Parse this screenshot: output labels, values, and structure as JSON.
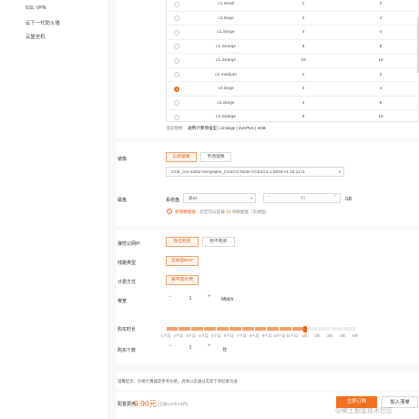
{
  "sidebar": {
    "items": [
      {
        "label": "SSL VPN"
      },
      {
        "label": "云下一代防火墙"
      },
      {
        "label": "云堡垒机"
      }
    ]
  },
  "spec_table": {
    "rows": [
      {
        "name": "c1.small",
        "vcpu": "1",
        "mem": "2",
        "selected": false
      },
      {
        "name": "c1.large",
        "vcpu": "2",
        "mem": "4",
        "selected": false
      },
      {
        "name": "c1.xlarge",
        "vcpu": "4",
        "mem": "4",
        "selected": false
      },
      {
        "name": "c1.2xlarge",
        "vcpu": "8",
        "mem": "8",
        "selected": false
      },
      {
        "name": "c1.4xlarge",
        "vcpu": "16",
        "mem": "16",
        "selected": false
      },
      {
        "name": "c2.medium",
        "vcpu": "1",
        "mem": "2",
        "selected": false
      },
      {
        "name": "c2.large",
        "vcpu": "2",
        "mem": "4",
        "selected": true
      },
      {
        "name": "c2.xlarge",
        "vcpu": "4",
        "mem": "8",
        "selected": false
      },
      {
        "name": "c2.2xlarge",
        "vcpu": "8",
        "mem": "16",
        "selected": false
      }
    ],
    "current_spec_label": "当前规格:",
    "current_spec_value": "通用计算增强型 | c2.large | 2vCPUs | 4GB"
  },
  "image": {
    "label": "镜像",
    "tabs": [
      {
        "label": "公共镜像",
        "active": true
      },
      {
        "label": "市场镜像",
        "active": false
      }
    ],
    "selected": "CCE_cce-addon-templates_CentOS-Node-CCE20.6.1.B003-v1.15.11-r1"
  },
  "disk": {
    "label": "磁盘",
    "system_label": "系统盘",
    "type": "高IO",
    "size": "40",
    "unit": "GB",
    "add_link": "新增数据盘",
    "add_hint_prefix": "您还可以挂载",
    "add_hint_count": "23",
    "add_hint_suffix": "块数据盘（云硬盘）"
  },
  "eip": {
    "label": "弹性公网IP",
    "options": [
      {
        "label": "现在购买",
        "active": true
      },
      {
        "label": "暂不购买",
        "active": false
      }
    ]
  },
  "line": {
    "label": "线路类型",
    "options": [
      {
        "label": "全动态BGP",
        "active": true
      }
    ]
  },
  "billing": {
    "label": "计费方式",
    "options": [
      {
        "label": "按带宽计费",
        "active": true
      }
    ]
  },
  "bandwidth": {
    "label": "带宽",
    "minus": "−",
    "value": "1",
    "plus": "+",
    "unit": "Mbit/s"
  },
  "duration": {
    "label": "购买时长",
    "ticks": [
      "1个月",
      "2个月",
      "3个月",
      "4个月",
      "5个月",
      "6个月",
      "7个月",
      "8个月",
      "9个月",
      "10个月",
      "11个月",
      "1年",
      "2年",
      "3年",
      "4年",
      "5年"
    ],
    "selected_index": 11,
    "selected_fraction": 0.7333
  },
  "quantity": {
    "label": "购买个数",
    "minus": "−",
    "value": "1",
    "plus": "+",
    "unit": "台"
  },
  "notice": "温馨提示：价格计算器是参考价格，具体以您通过实际下单结果为准",
  "footer": {
    "price_label": "配置费用",
    "price": "9.90元",
    "original": "(立省2,270.10元)",
    "buy_button": "立即订购",
    "cart_button": "加入清单"
  },
  "watermark": "@稀土掘金技术社区",
  "colors": {
    "accent": "#f27020",
    "accent_light": "#fff4ec"
  }
}
